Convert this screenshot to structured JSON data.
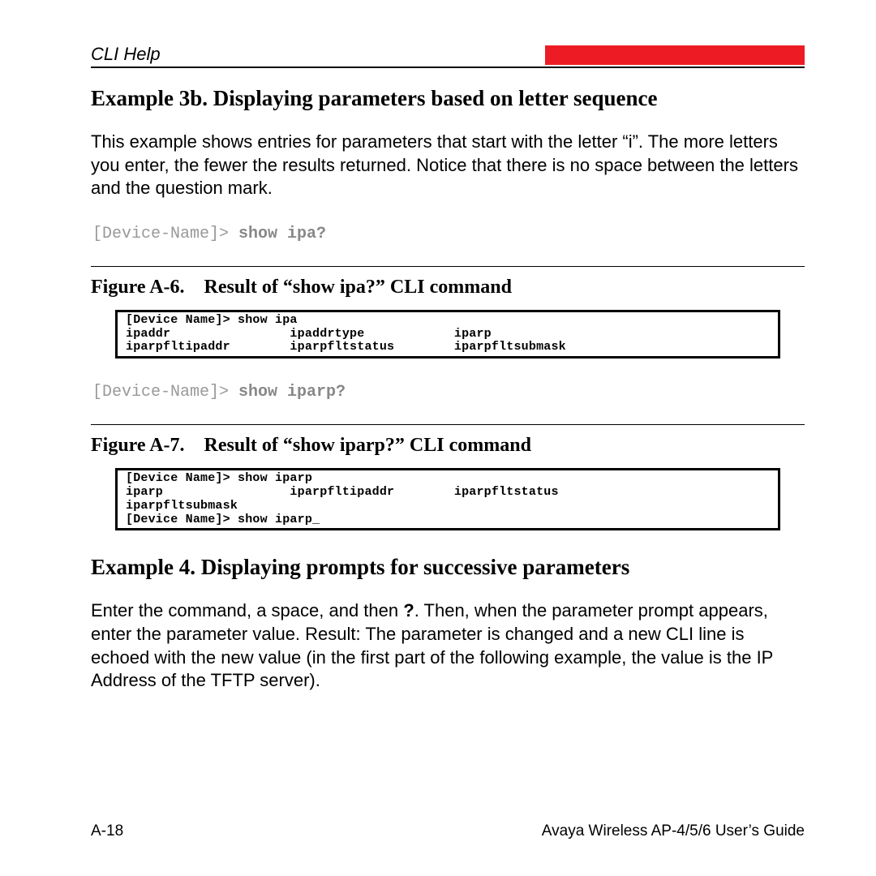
{
  "header": {
    "section": "CLI Help"
  },
  "example3b": {
    "heading": "Example 3b. Displaying parameters based on letter sequence",
    "para": "This example shows entries for parameters that start with the letter “i”. The more letters you enter, the fewer the results returned. Notice that there is no space between the letters and the question mark."
  },
  "cmd1": {
    "prompt": "[Device-Name]>",
    "command": "show ipa?"
  },
  "figA6": {
    "caption": "Figure A-6. Result of “show ipa?” CLI command",
    "terminal": "[Device Name]> show ipa\nipaddr                ipaddrtype            iparp\niparpfltipaddr        iparpfltstatus        iparpfltsubmask"
  },
  "cmd2": {
    "prompt": "[Device-Name]>",
    "command": "show iparp?"
  },
  "figA7": {
    "caption": "Figure A-7. Result of “show iparp?” CLI command",
    "terminal": "[Device Name]> show iparp\niparp                 iparpfltipaddr        iparpfltstatus\niparpfltsubmask\n[Device Name]> show iparp_"
  },
  "example4": {
    "heading": "Example 4. Displaying prompts for successive parameters",
    "para_pre": "Enter the command, a space, and then ",
    "para_bold": "?",
    "para_post": ". Then, when the parameter prompt appears, enter the parameter value. Result: The parameter is changed and a new CLI line is echoed with the new value (in the first part of the following example, the value is the IP Address of the TFTP server)."
  },
  "footer": {
    "page": "A-18",
    "guide": "Avaya Wireless AP-4/5/6 User’s Guide"
  }
}
